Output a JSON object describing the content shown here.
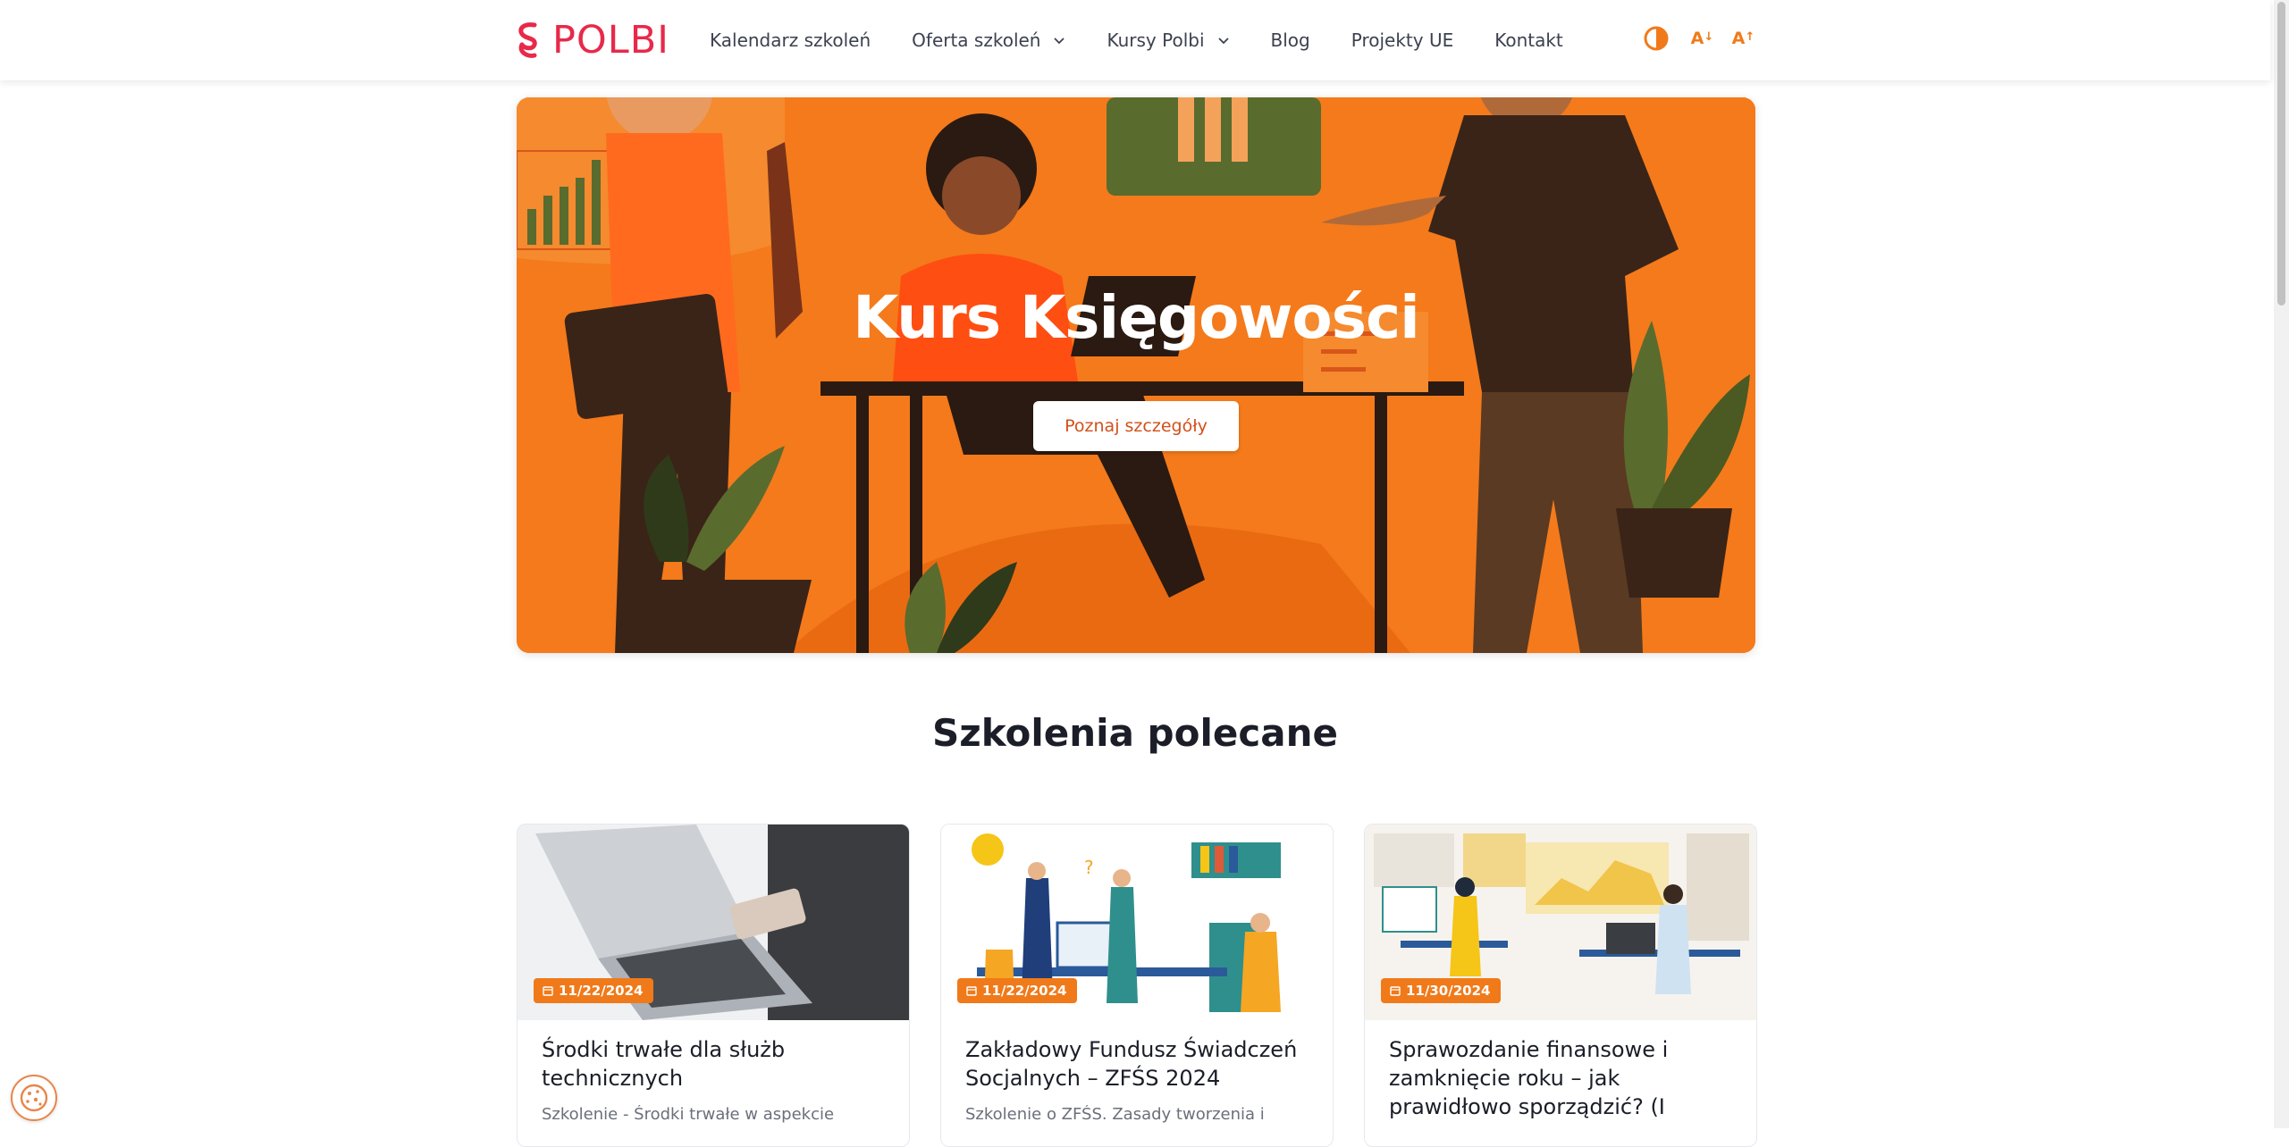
{
  "brand": {
    "name": "POLBI",
    "color": "#e8294a",
    "accent": "#f07a1a"
  },
  "nav": {
    "items": [
      {
        "label": "Kalendarz szkoleń",
        "dropdown": false
      },
      {
        "label": "Oferta szkoleń",
        "dropdown": true
      },
      {
        "label": "Kursy Polbi",
        "dropdown": true
      },
      {
        "label": "Blog",
        "dropdown": false
      },
      {
        "label": "Projekty UE",
        "dropdown": false
      },
      {
        "label": "Kontakt",
        "dropdown": false
      }
    ]
  },
  "tools": {
    "contrast_icon": "contrast-icon",
    "decrease_font": "A",
    "increase_font": "A"
  },
  "hero": {
    "title": "Kurs Księgowości",
    "button_label": "Poznaj szczegóły"
  },
  "section": {
    "title": "Szkolenia polecane"
  },
  "cards": [
    {
      "date": "11/22/2024",
      "title": "Środki trwałe dla służb technicznych",
      "description": "Szkolenie - Środki trwałe w aspekcie"
    },
    {
      "date": "11/22/2024",
      "title": "Zakładowy Fundusz Świadczeń Socjalnych – ZFŚS 2024",
      "description": "Szkolenie o ZFŚS. Zasady tworzenia i"
    },
    {
      "date": "11/30/2024",
      "title": "Sprawozdanie finansowe i zamknięcie roku – jak prawidłowo sporządzić? (I",
      "description": ""
    }
  ],
  "cookie": {
    "icon": "cookie-icon"
  }
}
